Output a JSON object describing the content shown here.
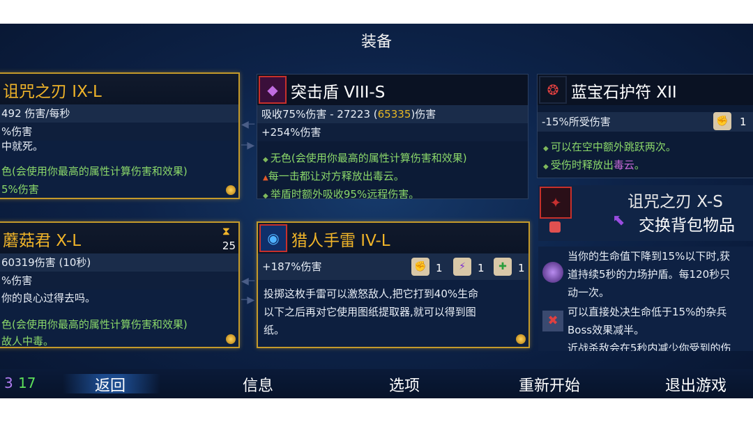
{
  "title": "装备",
  "colors": {
    "gold": "#f0b429",
    "green": "#8bd86a",
    "highlight": "#e9b824",
    "bg": "#0d2349"
  },
  "card1": {
    "name": "诅咒之刃  IX-L",
    "stat1": "492 伤害/每秒",
    "stat2": "%伤害",
    "desc1": "中就死。",
    "desc2": "色(会使用你最高的属性计算伤害和效果)",
    "desc3": "5%伤害"
  },
  "card2": {
    "name": "突击盾  VIII-S",
    "stat1_pre": "吸收75%伤害 - 27223 (",
    "stat1_hl": "65335",
    "stat1_post": ")伤害",
    "stat2": "+254%伤害",
    "line1": "无色(会使用你最高的属性计算伤害和效果)",
    "line2": "每一击都让对方释放出毒云。",
    "line3": "举盾时额外吸收95%远程伤害。"
  },
  "card3": {
    "name": "蓝宝石护符  XII",
    "stat1": "-15%所受伤害",
    "scroll_count": "1",
    "line1": "可以在空中额外跳跃两次。",
    "line2_pre": "受伤时释放出",
    "line2_hl": "毒云",
    "line2_post": "。"
  },
  "card4": {
    "name": "蘑菇君  X-L",
    "timer": "25",
    "stat1": "60319伤害 (10秒)",
    "stat2": "%伤害",
    "desc1": "你的良心过得去吗。",
    "desc2": "色(会使用你最高的属性计算伤害和效果)",
    "desc3": "故人中毒。"
  },
  "card5": {
    "name": "猎人手雷  IV-L",
    "stat1": "+187%伤害",
    "scroll1": "1",
    "scroll2": "1",
    "scroll3": "1",
    "desc1": "投掷这枚手雷可以激怒敌人,把它打到40%生命",
    "desc2": "以下之后再对它使用图纸提取器,就可以得到图",
    "desc3": "纸。"
  },
  "swap": {
    "name": "诅咒之刃  X-S",
    "label": "交换背包物品",
    "info1": "当你的生命值下降到15%以下时,获",
    "info2": "道持续5秒的力场护盾。每120秒只",
    "info3": "动一次。",
    "info4": "可以直接处决生命低于15%的杂兵",
    "info5": "Boss效果减半。",
    "info6": "近战杀敌会在5秒内减少你受到的伤"
  },
  "bottom": {
    "count_a": "3",
    "count_b": "17",
    "back": "返回",
    "info": "信息",
    "options": "选项",
    "restart": "重新开始",
    "quit": "退出游戏"
  }
}
